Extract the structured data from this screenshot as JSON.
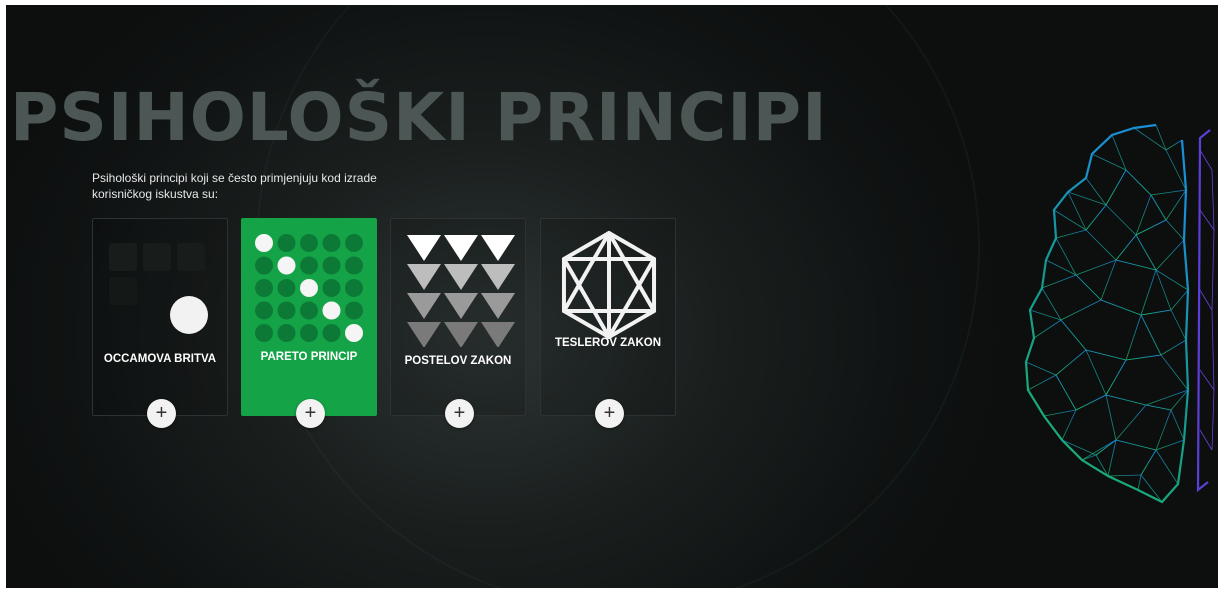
{
  "page": {
    "title": "PSIHOLOŠKI PRINCIPI",
    "intro": "Psihološki principi koji se često primjenjuju kod izrade korisničkog iskustva su:"
  },
  "cards": [
    {
      "label": "OCCAMOVA BRITVA",
      "icon": "occam-razor-icon",
      "active": false
    },
    {
      "label": "PARETO PRINCIP",
      "icon": "pareto-dots-icon",
      "active": true
    },
    {
      "label": "POSTELOV ZAKON",
      "icon": "triangles-grid-icon",
      "active": false
    },
    {
      "label": "TESLEROV ZAKON",
      "icon": "hexagon-network-icon",
      "active": false
    }
  ],
  "card_button_symbol": "+",
  "colors": {
    "background": "#111515",
    "accent_green": "#14a447",
    "title_gray": "#4b5655",
    "brain_gradient": [
      "#1fb56a",
      "#1a8fd6",
      "#6a3fd8"
    ]
  }
}
